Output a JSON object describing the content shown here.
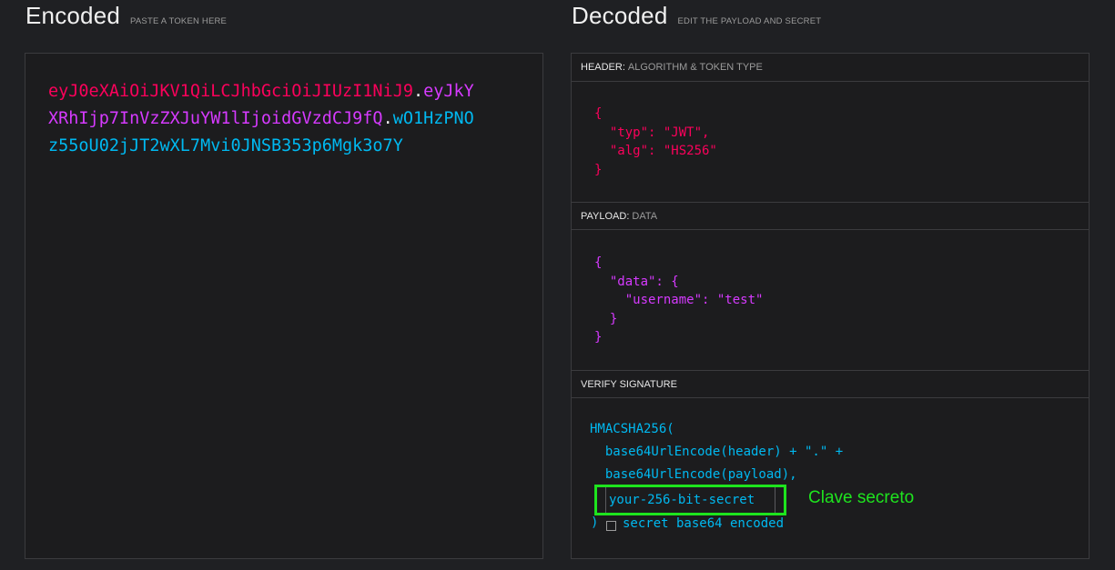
{
  "encoded": {
    "title": "Encoded",
    "subtitle": "PASTE A TOKEN HERE",
    "token": {
      "header": "eyJ0eXAiOiJKV1QiLCJhbGciOiJIUzI1NiJ9",
      "dot1": ".",
      "payload": "eyJkYXRhIjp7InVzZXJuYW1lIjoidGVzdCJ9fQ",
      "dot2": ".",
      "signature": "wO1HzPNOz55oU02jJT2wXL7Mvi0JNSB353p6Mgk3o7Y"
    }
  },
  "decoded": {
    "title": "Decoded",
    "subtitle": "EDIT THE PAYLOAD AND SECRET",
    "header_section": {
      "label": "HEADER:",
      "sublabel": "ALGORITHM & TOKEN TYPE",
      "json_text": "{\n  \"typ\": \"JWT\",\n  \"alg\": \"HS256\"\n}"
    },
    "payload_section": {
      "label": "PAYLOAD:",
      "sublabel": "DATA",
      "json_text": "{\n  \"data\": {\n    \"username\": \"test\"\n  }\n}"
    },
    "signature_section": {
      "label": "VERIFY SIGNATURE",
      "code_text": "HMACSHA256(\n  base64UrlEncode(header) + \".\" +\n  base64UrlEncode(payload),",
      "secret_value": "your-256-bit-secret",
      "close_paren": ")",
      "base64_label": "secret base64 encoded",
      "base64_checked": false,
      "annotation": "Clave secreto"
    }
  },
  "colors": {
    "header": "#fb015b",
    "payload": "#d63aff",
    "signature": "#00b9f1",
    "annotation": "#1ee41e"
  }
}
